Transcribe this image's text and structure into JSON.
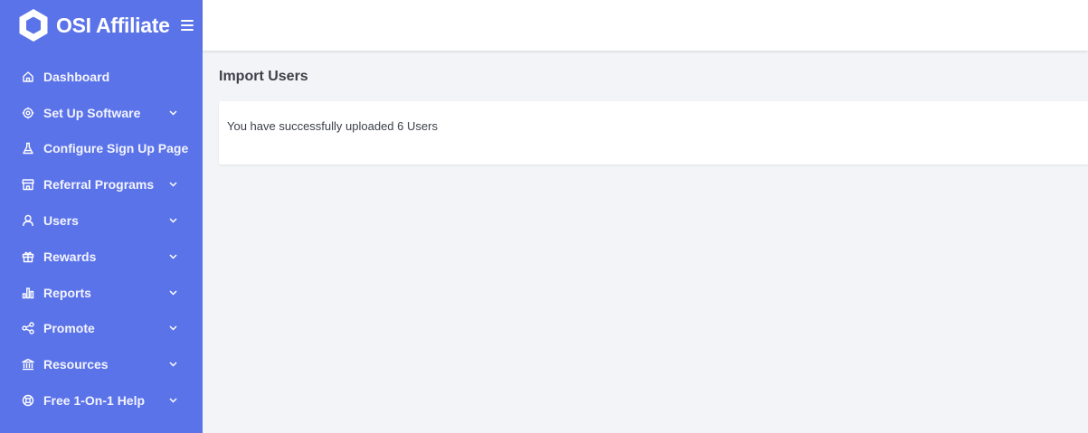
{
  "brand": {
    "name": "OSI Affiliate",
    "logo_icon": "hexagon-logo-icon"
  },
  "colors": {
    "sidebar": "#5b73e8",
    "page_background": "#f3f4f7",
    "text": "#3c4049"
  },
  "sidebar": {
    "items": [
      {
        "label": "Dashboard",
        "icon": "home-icon",
        "has_submenu": false
      },
      {
        "label": "Set Up Software",
        "icon": "gear-icon",
        "has_submenu": true
      },
      {
        "label": "Configure Sign Up Page",
        "icon": "flask-icon",
        "has_submenu": false
      },
      {
        "label": "Referral Programs",
        "icon": "store-icon",
        "has_submenu": true
      },
      {
        "label": "Users",
        "icon": "user-icon",
        "has_submenu": true
      },
      {
        "label": "Rewards",
        "icon": "gift-icon",
        "has_submenu": true
      },
      {
        "label": "Reports",
        "icon": "bar-chart-icon",
        "has_submenu": true
      },
      {
        "label": "Promote",
        "icon": "share-icon",
        "has_submenu": true
      },
      {
        "label": "Resources",
        "icon": "bank-icon",
        "has_submenu": true
      },
      {
        "label": "Free 1-On-1 Help",
        "icon": "lifebuoy-icon",
        "has_submenu": true
      }
    ]
  },
  "main": {
    "title": "Import Users",
    "message": "You have successfully uploaded 6 Users"
  }
}
